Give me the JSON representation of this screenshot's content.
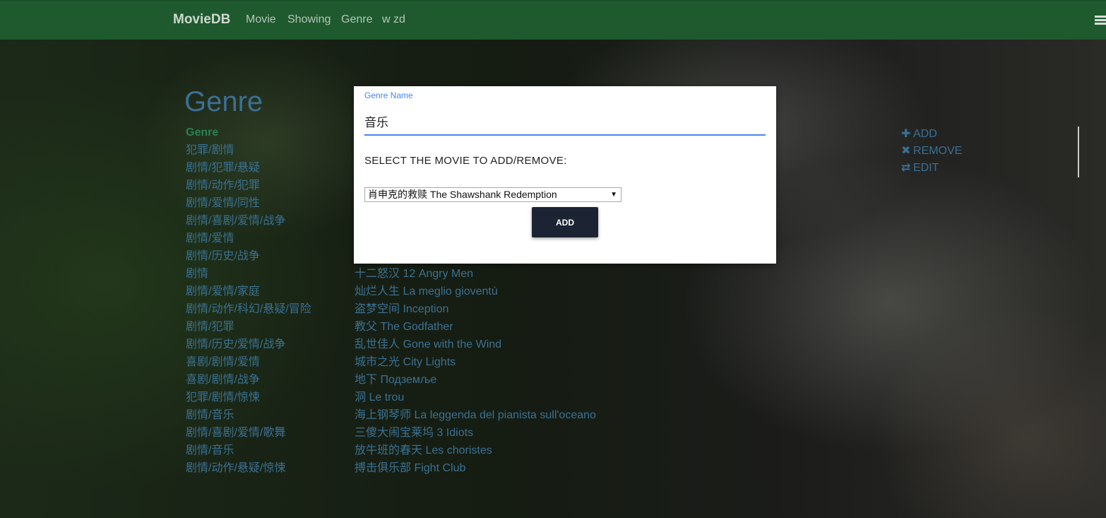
{
  "navbar": {
    "brand": "MovieDB",
    "links": [
      "Movie",
      "Showing",
      "Genre",
      "w zd"
    ],
    "background": "#1e5a2e",
    "menu_icon": "hamburger-icon"
  },
  "page": {
    "heading": "Genre",
    "genre_list": [
      "Genre",
      "犯罪/剧情",
      "剧情/犯罪/悬疑",
      "剧情/动作/犯罪",
      "剧情/爱情/同性",
      "剧情/喜剧/爱情/战争",
      "剧情/爱情",
      "剧情/历史/战争",
      "剧情",
      "剧情/爱情/家庭",
      "剧情/动作/科幻/悬疑/冒险",
      "剧情/犯罪",
      "剧情/历史/爱情/战争",
      "喜剧/剧情/爱情",
      "喜剧/剧情/战争",
      "犯罪/剧情/惊悚",
      "剧情/音乐",
      "剧情/喜剧/爱情/歌舞",
      "剧情/音乐",
      "剧情/动作/悬疑/惊悚"
    ],
    "movie_list": [
      "十二怒汉 12 Angry Men",
      "灿烂人生 La meglio gioventù",
      "盗梦空间 Inception",
      "教父 The Godfather",
      "乱世佳人 Gone with the Wind",
      "城市之光 City Lights",
      "地下 Подземље",
      "洞 Le trou",
      "海上钢琴师 La leggenda del pianista sull'oceano",
      "三傻大闹宝莱坞 3 Idiots",
      "放牛班的春天 Les choristes",
      "搏击俱乐部 Fight Club"
    ],
    "actions": {
      "add": "ADD",
      "remove": "REMOVE",
      "edit": "EDIT"
    }
  },
  "modal": {
    "field_label": "Genre Name",
    "field_value": "音乐",
    "select_label": "SELECT THE MOVIE TO ADD/REMOVE:",
    "selected_movie": "肖申克的救赎 The Shawshank Redemption",
    "button_label": "ADD",
    "accent": "#4285f4",
    "button_color": "#1c2333"
  }
}
